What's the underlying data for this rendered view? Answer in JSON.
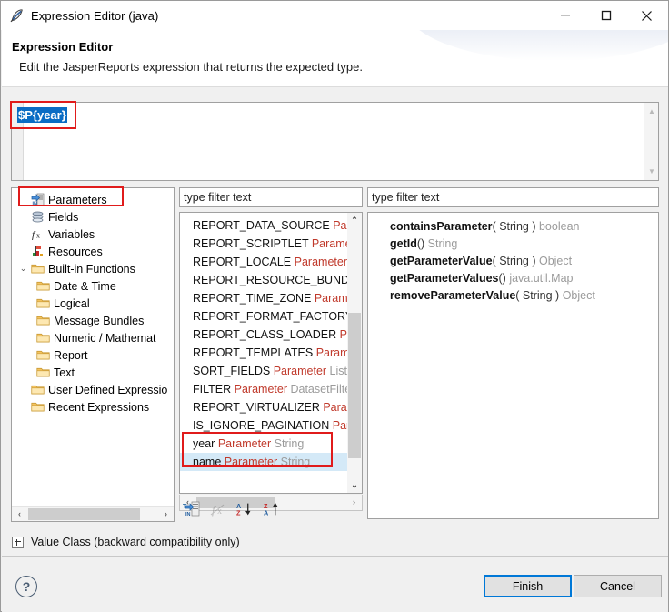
{
  "window": {
    "title": "Expression Editor (java)",
    "icon": "pen-icon",
    "minimize_label": "—",
    "maximize_label": "□",
    "close_label": "✕"
  },
  "header": {
    "title": "Expression Editor",
    "description": "Edit the JasperReports expression that returns the expected type."
  },
  "expression": {
    "value": "$P{year}",
    "selected": true,
    "scroll_up": "▲",
    "scroll_down": "▼"
  },
  "tree": {
    "items": [
      {
        "label": "Parameters",
        "icon": "parameters-icon",
        "indent": 0,
        "twisty": "",
        "highlighted": true
      },
      {
        "label": "Fields",
        "icon": "fields-icon",
        "indent": 0,
        "twisty": ""
      },
      {
        "label": "Variables",
        "icon": "variables-fx-icon",
        "indent": 0,
        "twisty": ""
      },
      {
        "label": "Resources",
        "icon": "resources-icon",
        "indent": 0,
        "twisty": ""
      },
      {
        "label": "Built-in Functions",
        "icon": "folder-icon",
        "indent": 0,
        "twisty": "⌄"
      },
      {
        "label": "Date & Time",
        "icon": "folder-icon",
        "indent": 1,
        "twisty": ""
      },
      {
        "label": "Logical",
        "icon": "folder-icon",
        "indent": 1,
        "twisty": ""
      },
      {
        "label": "Message Bundles",
        "icon": "folder-icon",
        "indent": 1,
        "twisty": ""
      },
      {
        "label": "Numeric / Mathemat",
        "icon": "folder-icon",
        "indent": 1,
        "twisty": ""
      },
      {
        "label": "Report",
        "icon": "folder-icon",
        "indent": 1,
        "twisty": ""
      },
      {
        "label": "Text",
        "icon": "folder-icon",
        "indent": 1,
        "twisty": ""
      },
      {
        "label": "User Defined Expressio",
        "icon": "folder-icon",
        "indent": 0,
        "twisty": ""
      },
      {
        "label": "Recent Expressions",
        "icon": "folder-icon",
        "indent": 0,
        "twisty": ""
      }
    ],
    "hscroll_left": "‹",
    "hscroll_right": "›"
  },
  "middle": {
    "filter_placeholder": "type filter text",
    "filter_value": "",
    "scroll_up": "⌃",
    "scroll_down": "⌄",
    "hscroll_left": "‹",
    "hscroll_right": "›",
    "items": [
      {
        "name": "REPORT_DATA_SOURCE",
        "kind": "Parar",
        "type": ""
      },
      {
        "name": "REPORT_SCRIPTLET",
        "kind": "Paramete",
        "type": ""
      },
      {
        "name": "REPORT_LOCALE",
        "kind": "Parameter",
        "type": "L"
      },
      {
        "name": "REPORT_RESOURCE_BUNDLE",
        "kind": "",
        "type": ""
      },
      {
        "name": "REPORT_TIME_ZONE",
        "kind": "Paramet",
        "type": ""
      },
      {
        "name": "REPORT_FORMAT_FACTORY",
        "kind": "P",
        "type": ""
      },
      {
        "name": "REPORT_CLASS_LOADER",
        "kind": "Para",
        "type": ""
      },
      {
        "name": "REPORT_TEMPLATES",
        "kind": "Paramet",
        "type": ""
      },
      {
        "name": "SORT_FIELDS",
        "kind": "Parameter",
        "type": "List"
      },
      {
        "name": "FILTER",
        "kind": "Parameter",
        "type": "DatasetFilte"
      },
      {
        "name": "REPORT_VIRTUALIZER",
        "kind": "Parame",
        "type": ""
      },
      {
        "name": "IS_IGNORE_PAGINATION",
        "kind": "Para",
        "type": ""
      },
      {
        "name": "year",
        "kind": "Parameter",
        "type": "String"
      },
      {
        "name": "name",
        "kind": "Parameter",
        "type": "String",
        "selected": true
      }
    ],
    "toolbar": [
      {
        "name": "show-parameters-icon",
        "enabled": true
      },
      {
        "name": "show-functions-fx-icon",
        "enabled": false
      },
      {
        "name": "sort-ascending-icon",
        "enabled": true
      },
      {
        "name": "sort-descending-icon",
        "enabled": true
      }
    ]
  },
  "right": {
    "filter_placeholder": "type filter text",
    "filter_value": "",
    "methods": [
      {
        "name": "containsParameter",
        "args": "( String )",
        "ret": "boolean"
      },
      {
        "name": "getId",
        "args": "()",
        "ret": "String"
      },
      {
        "name": "getParameterValue",
        "args": "( String )",
        "ret": "Object"
      },
      {
        "name": "getParameterValues",
        "args": "()",
        "ret": "java.util.Map"
      },
      {
        "name": "removeParameterValue",
        "args": "( String )",
        "ret": "Object"
      }
    ]
  },
  "value_class": {
    "label": "Value Class (backward compatibility only)",
    "expanded": false
  },
  "footer": {
    "help_label": "?",
    "finish_label": "Finish",
    "cancel_label": "Cancel"
  },
  "colors": {
    "selection_blue": "#0a6cc4",
    "annotation_red": "#e01b1b",
    "row_selected": "#d4e9f7",
    "focus_blue": "#0078d7",
    "kind_red": "#c0392b",
    "type_gray": "#9b9b9b"
  }
}
